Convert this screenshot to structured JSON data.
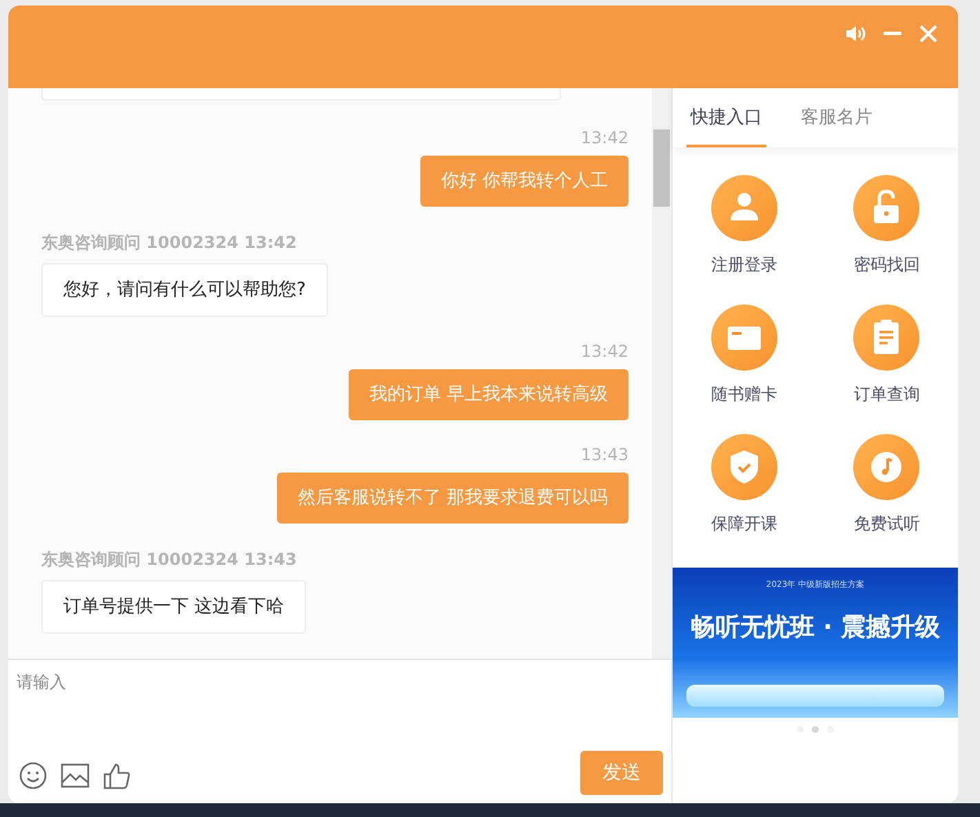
{
  "header": {
    "controls": [
      {
        "kind": "sound"
      },
      {
        "kind": "minimize"
      },
      {
        "kind": "close"
      }
    ]
  },
  "chat": {
    "messages": [
      {
        "kind": "sent",
        "time": "13:42",
        "text": "你好 你帮我转个人工"
      },
      {
        "kind": "received",
        "meta": "东奥咨询顾问 10002324 13:42",
        "text": "您好，请问有什么可以帮助您?"
      },
      {
        "kind": "sent",
        "time": "13:42",
        "text": "我的订单 早上我本来说转高级"
      },
      {
        "kind": "sent",
        "time": "13:43",
        "text": "然后客服说转不了 那我要求退费可以吗"
      },
      {
        "kind": "received",
        "meta": "东奥咨询顾问 10002324 13:43",
        "text": "订单号提供一下 这边看下哈"
      }
    ]
  },
  "composer": {
    "placeholder": "请输入",
    "tools": [
      {
        "kind": "emoji"
      },
      {
        "kind": "image"
      },
      {
        "kind": "like"
      }
    ],
    "send": "发送"
  },
  "side": {
    "tabs": [
      {
        "label": "快捷入口",
        "selected": true
      },
      {
        "label": "客服名片",
        "selected": false
      }
    ],
    "shortcuts": [
      {
        "kind": "user",
        "label": "注册登录"
      },
      {
        "kind": "lock",
        "label": "密码找回"
      },
      {
        "kind": "card",
        "label": "随书赠卡"
      },
      {
        "kind": "clipboard",
        "label": "订单查询"
      },
      {
        "kind": "shield",
        "label": "保障开课"
      },
      {
        "kind": "music",
        "label": "免费试听"
      }
    ],
    "banner": {
      "subtitle": "2023年 中级新版招生方案",
      "headline": "畅听无忧班 · 震撼升级"
    },
    "dots": [
      {
        "selected": false
      },
      {
        "selected": true
      },
      {
        "selected": false
      }
    ]
  }
}
